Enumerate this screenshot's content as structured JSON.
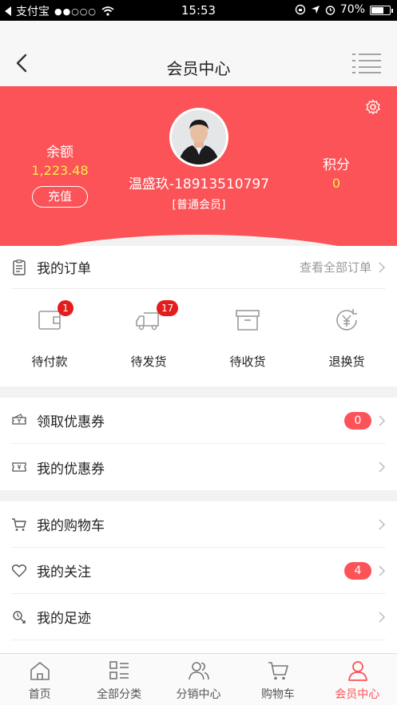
{
  "status_bar": {
    "carrier": "支付宝",
    "signal": "●●○○○",
    "time": "15:53",
    "battery": "70%",
    "battery_level": 0.7
  },
  "nav": {
    "title": "会员中心"
  },
  "profile": {
    "balance_label": "余额",
    "balance_value": "1,223.48",
    "recharge_label": "充值",
    "name": "温盛玖-18913510797",
    "level": "[普通会员]",
    "points_label": "积分",
    "points_value": "0"
  },
  "orders": {
    "title": "我的订单",
    "view_all": "查看全部订单",
    "items": [
      {
        "label": "待付款",
        "badge": "1",
        "icon": "wallet-icon"
      },
      {
        "label": "待发货",
        "badge": "17",
        "icon": "truck-icon"
      },
      {
        "label": "待收货",
        "badge": "",
        "icon": "box-icon"
      },
      {
        "label": "退换货",
        "badge": "",
        "icon": "yen-return-icon"
      }
    ]
  },
  "coupons": {
    "get_coupons": {
      "label": "领取优惠券",
      "count": "0"
    },
    "my_coupons": {
      "label": "我的优惠券"
    }
  },
  "lists": {
    "cart": {
      "label": "我的购物车"
    },
    "follow": {
      "label": "我的关注",
      "count": "4"
    },
    "footprint": {
      "label": "我的足迹"
    }
  },
  "tabbar": {
    "items": [
      {
        "label": "首页",
        "icon": "home-icon"
      },
      {
        "label": "全部分类",
        "icon": "category-icon"
      },
      {
        "label": "分销中心",
        "icon": "people-icon"
      },
      {
        "label": "购物车",
        "icon": "cart-icon"
      },
      {
        "label": "会员中心",
        "icon": "user-icon"
      }
    ],
    "active_index": 4
  },
  "colors": {
    "accent": "#fb5357",
    "highlight": "#ffe94d",
    "badge": "#e41c1c"
  }
}
